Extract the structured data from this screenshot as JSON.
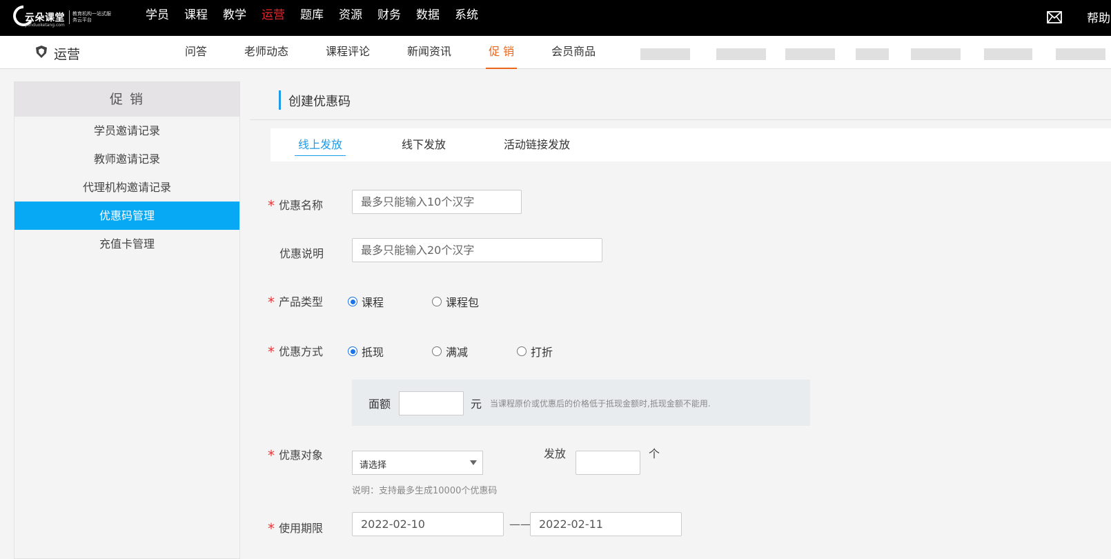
{
  "topbar": {
    "logo_text": "云朵课堂",
    "logo_subtext": "yunduoketang.com",
    "logo_slogan": "教育机构一站式服务云平台",
    "nav": [
      "学员",
      "课程",
      "教学",
      "运营",
      "题库",
      "资源",
      "财务",
      "数据",
      "系统"
    ],
    "active_nav": "运营",
    "help_label": "帮助"
  },
  "subbar": {
    "module_title": "运营",
    "nav": [
      "问答",
      "老师动态",
      "课程评论",
      "新闻资讯",
      "促 销",
      "会员商品"
    ],
    "active_nav": "促 销"
  },
  "sidebar": {
    "title": "促 销",
    "items": [
      "学员邀请记录",
      "教师邀请记录",
      "代理机构邀请记录",
      "优惠码管理",
      "充值卡管理"
    ],
    "active_item": "优惠码管理"
  },
  "page": {
    "title": "创建优惠码",
    "tabs": [
      "线上发放",
      "线下发放",
      "活动链接发放"
    ],
    "active_tab": "线上发放"
  },
  "form": {
    "name": {
      "label": "优惠名称",
      "required": true,
      "placeholder": "最多只能输入10个汉字",
      "value": ""
    },
    "desc": {
      "label": "优惠说明",
      "required": false,
      "placeholder": "最多只能输入20个汉字",
      "value": ""
    },
    "product_type": {
      "label": "产品类型",
      "required": true,
      "options": [
        "课程",
        "课程包"
      ],
      "selected": "课程"
    },
    "discount_method": {
      "label": "优惠方式",
      "required": true,
      "options": [
        "抵现",
        "满减",
        "打折"
      ],
      "selected": "抵现"
    },
    "face_value": {
      "label": "面额",
      "unit": "元",
      "note": "当课程原价或优惠后的价格低于抵现金额时,抵现金额不能用.",
      "value": ""
    },
    "target": {
      "label": "优惠对象",
      "required": true,
      "selected": "请选择",
      "hint": "说明：支持最多生成10000个优惠码"
    },
    "issue": {
      "label": "发放",
      "unit": "个",
      "value": ""
    },
    "period": {
      "label": "使用期限",
      "required": true,
      "start": "2022-02-10",
      "separator": "——",
      "end": "2022-02-11"
    }
  },
  "colors": {
    "topbar_bg": "#000000",
    "active_top_nav": "#e8262d",
    "active_sub_nav": "#e9661a",
    "sidebar_active": "#07a8f4",
    "tab_active": "#1e9be8",
    "required_star": "#e33333"
  },
  "icons": {
    "logo": "cloud-logo-icon",
    "mail": "mail-icon",
    "module": "shield-icon",
    "select": "caret-down-icon"
  }
}
